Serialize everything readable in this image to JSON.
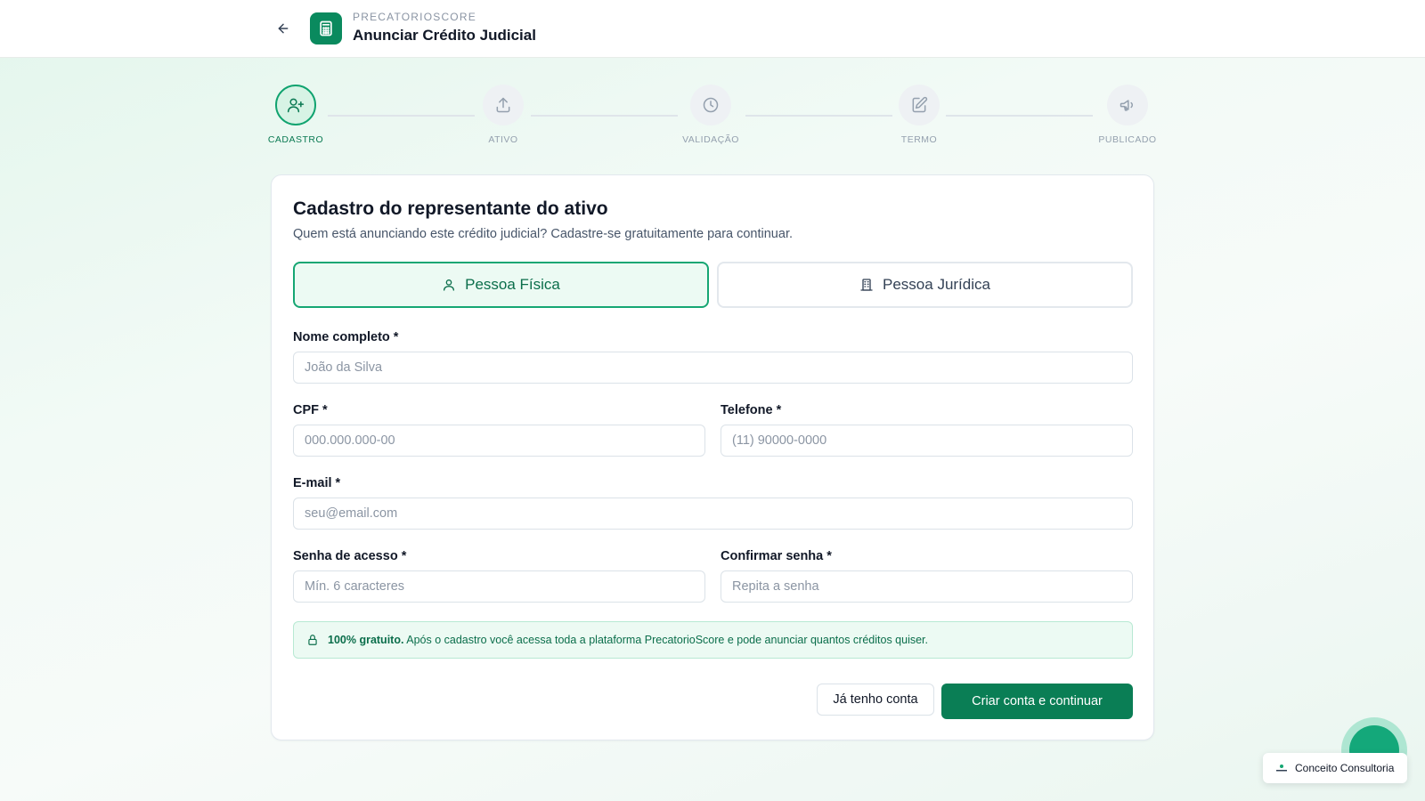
{
  "header": {
    "brand": "PRECATORIOSCORE",
    "title": "Anunciar Crédito Judicial"
  },
  "stepper": {
    "steps": [
      {
        "label": "CADASTRO",
        "icon": "user-plus-icon",
        "active": true
      },
      {
        "label": "ATIVO",
        "icon": "upload-icon",
        "active": false
      },
      {
        "label": "VALIDAÇÃO",
        "icon": "clock-icon",
        "active": false
      },
      {
        "label": "TERMO",
        "icon": "edit-document-icon",
        "active": false
      },
      {
        "label": "PUBLICADO",
        "icon": "megaphone-icon",
        "active": false
      }
    ]
  },
  "form": {
    "title": "Cadastro do representante do ativo",
    "subtitle": "Quem está anunciando este crédito judicial? Cadastre-se gratuitamente para continuar.",
    "type_pf": "Pessoa Física",
    "type_pj": "Pessoa Jurídica",
    "fields": {
      "nome": {
        "label": "Nome completo *",
        "placeholder": "João da Silva",
        "value": ""
      },
      "cpf": {
        "label": "CPF *",
        "placeholder": "000.000.000-00",
        "value": ""
      },
      "telefone": {
        "label": "Telefone *",
        "placeholder": "(11) 90000-0000",
        "value": ""
      },
      "email": {
        "label": "E-mail *",
        "placeholder": "seu@email.com",
        "value": ""
      },
      "senha": {
        "label": "Senha de acesso *",
        "placeholder": "Mín. 6 caracteres",
        "value": ""
      },
      "confirmar": {
        "label": "Confirmar senha *",
        "placeholder": "Repita a senha",
        "value": ""
      }
    },
    "info_bold": "100% gratuito.",
    "info_text": "Após o cadastro você acessa toda a plataforma PrecatorioScore e pode anunciar quantos créditos quiser.",
    "login_button": "Já tenho conta",
    "submit_button": "Criar conta e continuar"
  },
  "widgets": {
    "consult_badge": "Conceito Consultoria"
  },
  "colors": {
    "primary": "#0a7e55",
    "accent": "#16a673",
    "muted": "#94a0ae"
  }
}
